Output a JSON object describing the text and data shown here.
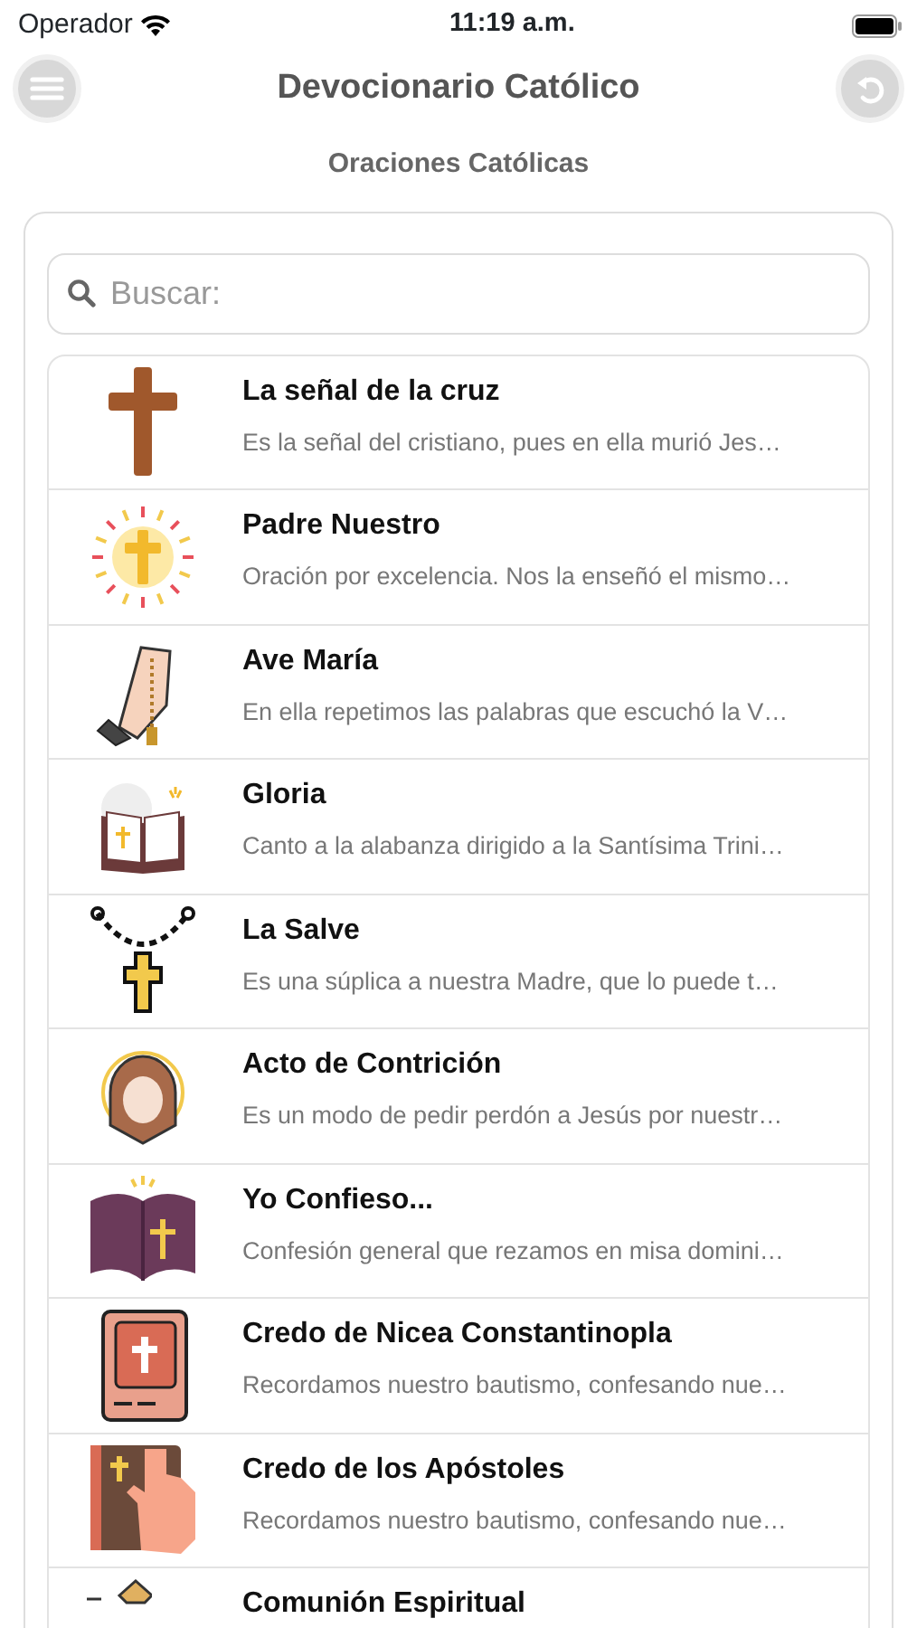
{
  "status_bar": {
    "carrier": "Operador",
    "time": "11:19 a.m."
  },
  "header": {
    "title": "Devocionario Católico"
  },
  "section_title": "Oraciones Católicas",
  "search": {
    "placeholder": "Buscar:"
  },
  "prayers": [
    {
      "title": "La señal de la cruz",
      "summary": "Es la señal del cristiano, pues en ella murió Jes…"
    },
    {
      "title": "Padre Nuestro",
      "summary": "Oración por excelencia. Nos la enseñó el mismo…"
    },
    {
      "title": "Ave María",
      "summary": "En ella repetimos las palabras que escuchó la V…"
    },
    {
      "title": "Gloria",
      "summary": "Canto a la alabanza dirigido a la Santísima Trini…"
    },
    {
      "title": "La Salve",
      "summary": "Es una súplica a nuestra Madre, que lo puede t…"
    },
    {
      "title": "Acto de Contrición",
      "summary": "Es un modo de pedir perdón a Jesús por nuestr…"
    },
    {
      "title": "Yo Confieso...",
      "summary": "Confesión general que rezamos en misa domini…"
    },
    {
      "title": "Credo de Nicea Constantinopla",
      "summary": "Recordamos nuestro bautismo, confesando nue…"
    },
    {
      "title": "Credo de los Apóstoles",
      "summary": "Recordamos nuestro bautismo, confesando nue…"
    },
    {
      "title": "Comunión Espiritual"
    }
  ]
}
